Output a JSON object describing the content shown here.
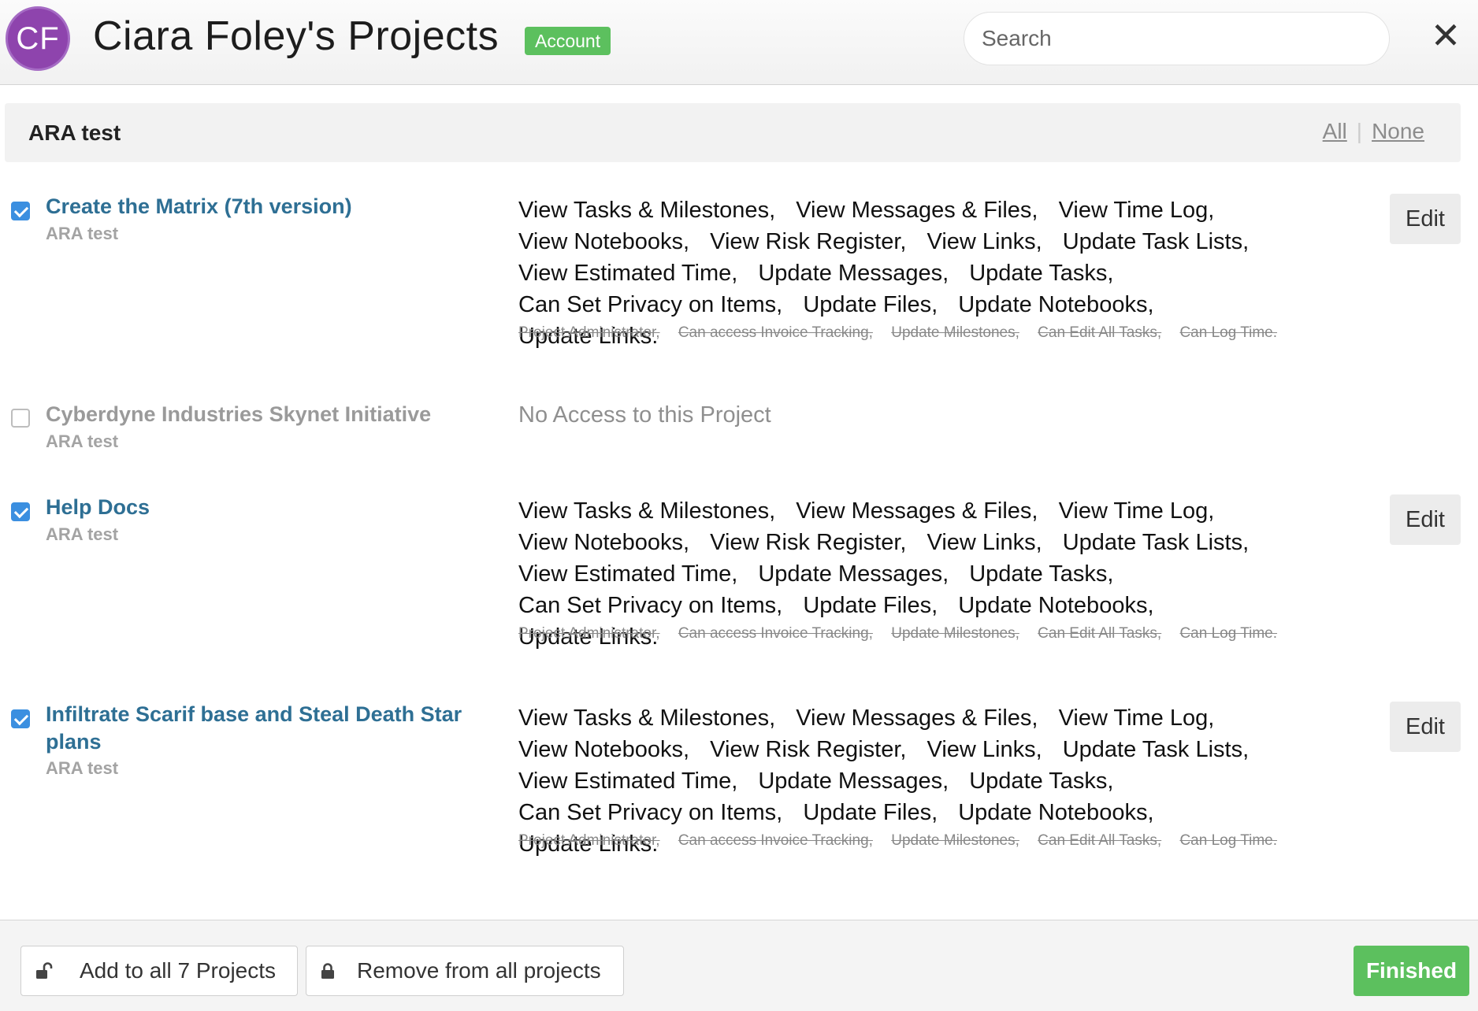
{
  "header": {
    "avatar_initials": "CF",
    "title": "Ciara Foley's Projects",
    "badge": "Account",
    "search_placeholder": "Search",
    "close_label": "✕"
  },
  "group": {
    "title": "ARA test",
    "all_label": "All",
    "separator": "|",
    "none_label": "None"
  },
  "projects": [
    {
      "name": "Create the Matrix (7th version)",
      "sub": "ARA test",
      "checked": true,
      "edit_label": "Edit",
      "perms": [
        "View Tasks & Milestones,",
        "View Messages & Files,",
        "View Time Log,",
        "View Notebooks,",
        "View Risk Register,",
        "View Links,",
        "Update Task Lists,",
        "View Estimated Time,",
        "Update Messages,",
        "Update Tasks,",
        "Can Set Privacy on Items,",
        "Update Files,",
        "Update Notebooks,",
        "Update Links."
      ],
      "perms_off": [
        "Project Administrator,",
        "Can access Invoice Tracking,",
        "Update Milestones,",
        "Can Edit All Tasks,",
        "Can Log Time."
      ]
    },
    {
      "name": "Cyberdyne Industries Skynet Initiative",
      "sub": "ARA test",
      "checked": false,
      "no_access": "No Access to this Project"
    },
    {
      "name": "Help Docs",
      "sub": "ARA test",
      "checked": true,
      "edit_label": "Edit",
      "perms": [
        "View Tasks & Milestones,",
        "View Messages & Files,",
        "View Time Log,",
        "View Notebooks,",
        "View Risk Register,",
        "View Links,",
        "Update Task Lists,",
        "View Estimated Time,",
        "Update Messages,",
        "Update Tasks,",
        "Can Set Privacy on Items,",
        "Update Files,",
        "Update Notebooks,",
        "Update Links."
      ],
      "perms_off": [
        "Project Administrator,",
        "Can access Invoice Tracking,",
        "Update Milestones,",
        "Can Edit All Tasks,",
        "Can Log Time."
      ]
    },
    {
      "name": "Infiltrate Scarif base and Steal Death Star plans",
      "sub": "ARA test",
      "checked": true,
      "edit_label": "Edit",
      "perms": [
        "View Tasks & Milestones,",
        "View Messages & Files,",
        "View Time Log,",
        "View Notebooks,",
        "View Risk Register,",
        "View Links,",
        "Update Task Lists,",
        "View Estimated Time,",
        "Update Messages,",
        "Update Tasks,",
        "Can Set Privacy on Items,",
        "Update Files,",
        "Update Notebooks,",
        "Update Links."
      ],
      "perms_off": [
        "Project Administrator,",
        "Can access Invoice Tracking,",
        "Update Milestones,",
        "Can Edit All Tasks,",
        "Can Log Time."
      ]
    }
  ],
  "footer": {
    "add_all_label": "Add to all 7 Projects",
    "remove_all_label": "Remove from all projects",
    "finished_label": "Finished"
  }
}
